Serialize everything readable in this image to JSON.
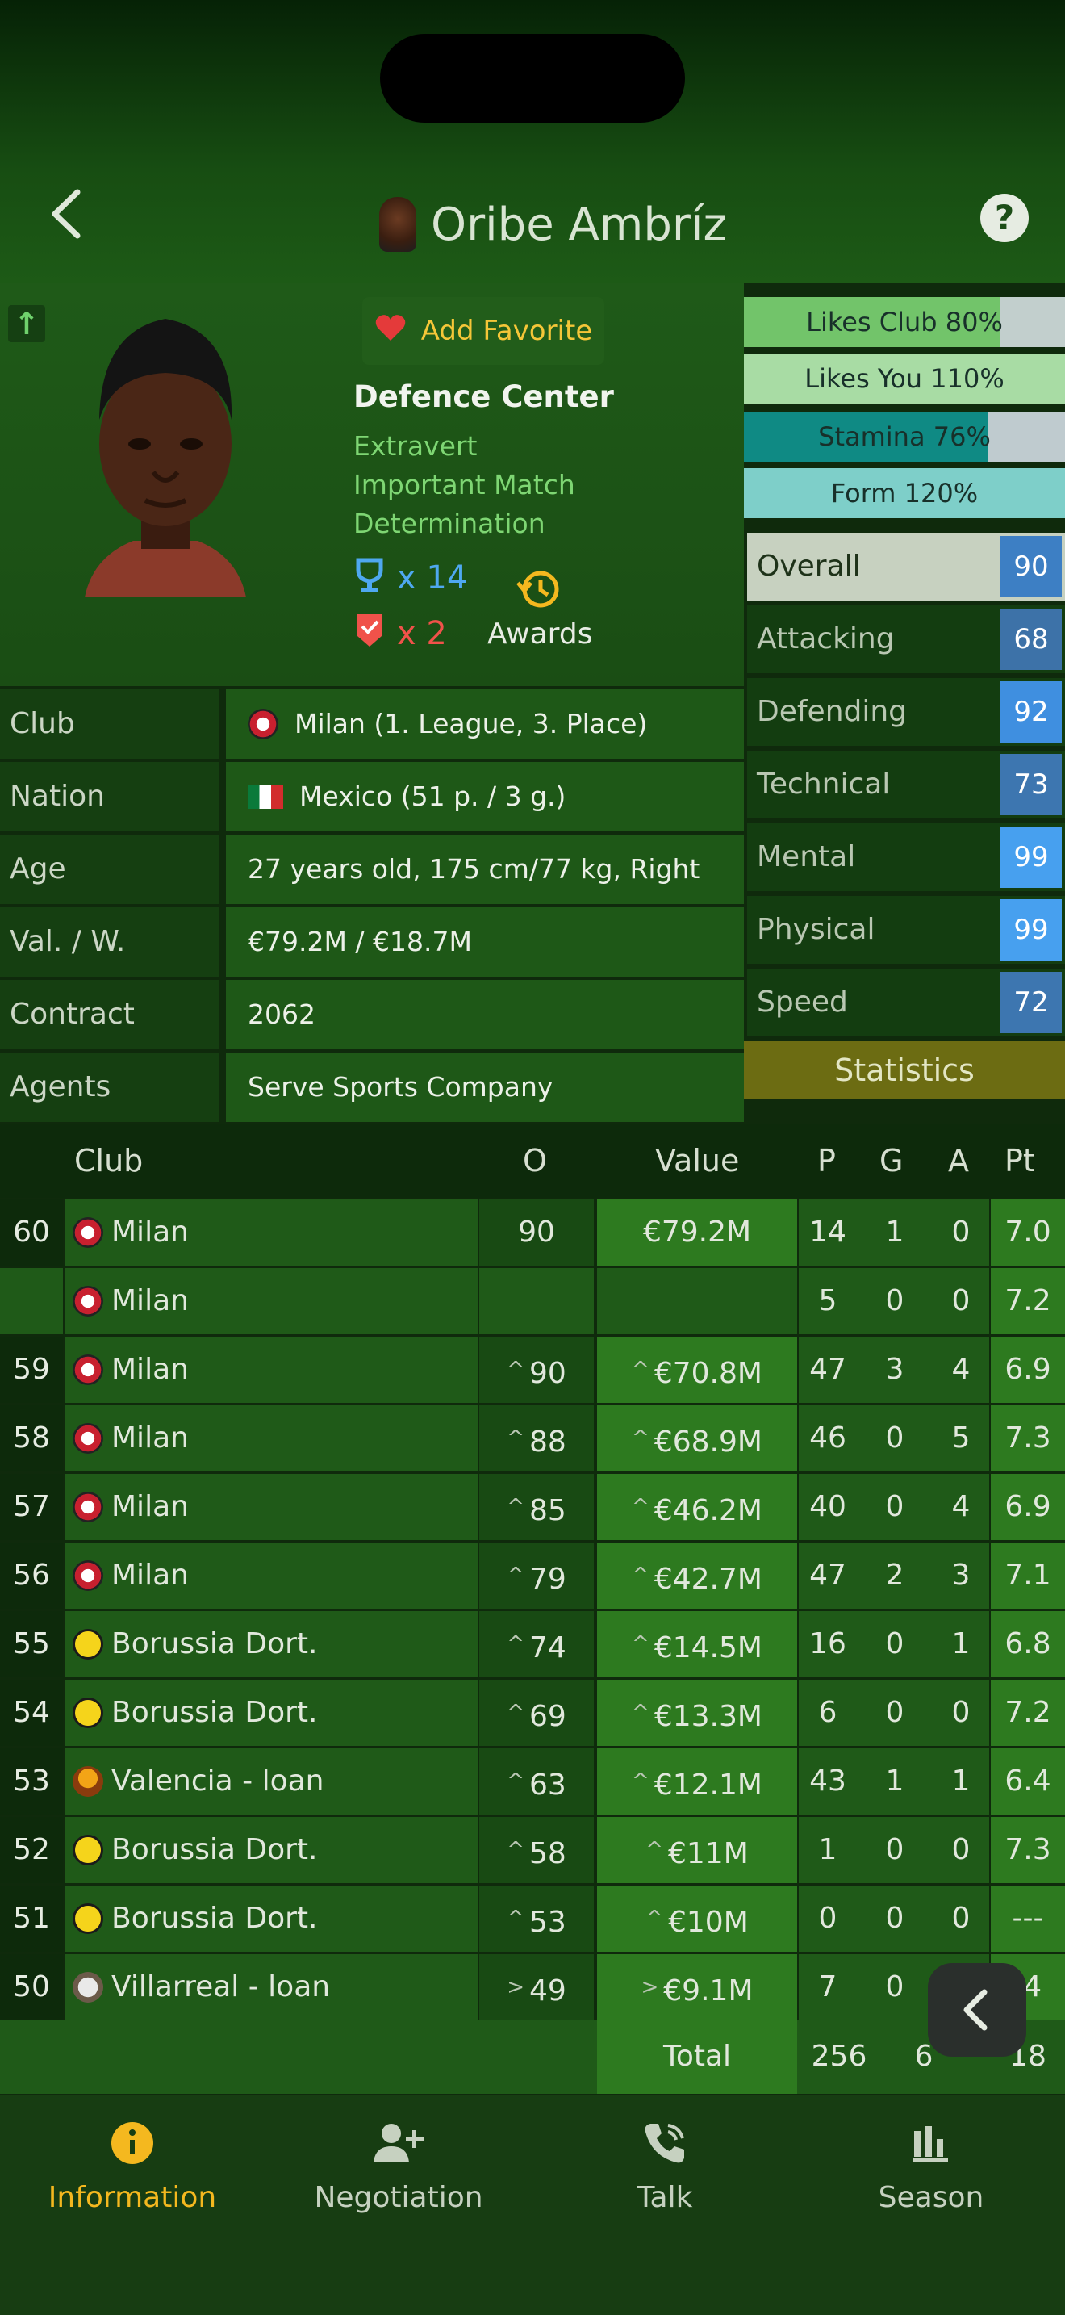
{
  "header": {
    "player_name": "Oribe Ambríz"
  },
  "profile": {
    "favorite_label": "Add Favorite",
    "position": "Defence Center",
    "traits": [
      "Extravert",
      "Important Match",
      "Determination"
    ],
    "trophies": "x 14",
    "red_cards": "x 2",
    "awards_label": "Awards"
  },
  "bars": [
    {
      "label": "Likes Club 80%",
      "pct": 80,
      "color": "#72c46a",
      "bg": "#c2cfcd"
    },
    {
      "label": "Likes You 110%",
      "pct": 100,
      "color": "#a8dca4",
      "bg": "#a8dca4"
    },
    {
      "label": "Stamina 76%",
      "pct": 76,
      "color": "#0f8a84",
      "bg": "#bfcbcf"
    },
    {
      "label": "Form 120%",
      "pct": 100,
      "color": "#7ecfc9",
      "bg": "#7ecfc9"
    }
  ],
  "attributes": [
    {
      "name": "Overall",
      "value": "90",
      "color": "#3d7fc4"
    },
    {
      "name": "Attacking",
      "value": "68",
      "color": "#3d72a8"
    },
    {
      "name": "Defending",
      "value": "92",
      "color": "#3f8fe0"
    },
    {
      "name": "Technical",
      "value": "73",
      "color": "#3d76b0"
    },
    {
      "name": "Mental",
      "value": "99",
      "color": "#47a0ef"
    },
    {
      "name": "Physical",
      "value": "99",
      "color": "#47a0ef"
    },
    {
      "name": "Speed",
      "value": "72",
      "color": "#3d76b0"
    }
  ],
  "statistics_label": "Statistics",
  "info": [
    {
      "key": "Club",
      "value": "Milan (1. League, 3. Place)"
    },
    {
      "key": "Nation",
      "value": "Mexico  (51 p. / 3 g.)"
    },
    {
      "key": "Age",
      "value": "27 years old, 175 cm/77 kg, Right"
    },
    {
      "key": "Val. / W.",
      "value": "€79.2M / €18.7M"
    },
    {
      "key": "Contract",
      "value": "2062"
    },
    {
      "key": "Agents",
      "value": "Serve Sports Company"
    }
  ],
  "table": {
    "headers": {
      "club": "Club",
      "o": "O",
      "value": "Value",
      "p": "P",
      "g": "G",
      "a": "A",
      "pt": "Pt"
    },
    "rows": [
      {
        "season": "60",
        "crest": "milan",
        "club": "Milan",
        "o": "90",
        "value": "€79.2M",
        "p": "14",
        "g": "1",
        "a": "0",
        "pt": "7.0",
        "up": ""
      },
      {
        "season": "",
        "crest": "milan",
        "club": "Milan",
        "o": "",
        "value": "",
        "p": "5",
        "g": "0",
        "a": "0",
        "pt": "7.2",
        "up": ""
      },
      {
        "season": "59",
        "crest": "milan",
        "club": "Milan",
        "o": "90",
        "value": "€70.8M",
        "p": "47",
        "g": "3",
        "a": "4",
        "pt": "6.9",
        "up": "^"
      },
      {
        "season": "58",
        "crest": "milan",
        "club": "Milan",
        "o": "88",
        "value": "€68.9M",
        "p": "46",
        "g": "0",
        "a": "5",
        "pt": "7.3",
        "up": "^"
      },
      {
        "season": "57",
        "crest": "milan",
        "club": "Milan",
        "o": "85",
        "value": "€46.2M",
        "p": "40",
        "g": "0",
        "a": "4",
        "pt": "6.9",
        "up": "^"
      },
      {
        "season": "56",
        "crest": "milan",
        "club": "Milan",
        "o": "79",
        "value": "€42.7M",
        "p": "47",
        "g": "2",
        "a": "3",
        "pt": "7.1",
        "up": "^"
      },
      {
        "season": "55",
        "crest": "bvb",
        "club": "Borussia Dort.",
        "o": "74",
        "value": "€14.5M",
        "p": "16",
        "g": "0",
        "a": "1",
        "pt": "6.8",
        "up": "^"
      },
      {
        "season": "54",
        "crest": "bvb",
        "club": "Borussia Dort.",
        "o": "69",
        "value": "€13.3M",
        "p": "6",
        "g": "0",
        "a": "0",
        "pt": "7.2",
        "up": "^"
      },
      {
        "season": "53",
        "crest": "val",
        "club": "Valencia - loan",
        "o": "63",
        "value": "€12.1M",
        "p": "43",
        "g": "1",
        "a": "1",
        "pt": "6.4",
        "up": "^"
      },
      {
        "season": "52",
        "crest": "bvb",
        "club": "Borussia Dort.",
        "o": "58",
        "value": "€11M",
        "p": "1",
        "g": "0",
        "a": "0",
        "pt": "7.3",
        "up": "^"
      },
      {
        "season": "51",
        "crest": "bvb",
        "club": "Borussia Dort.",
        "o": "53",
        "value": "€10M",
        "p": "0",
        "g": "0",
        "a": "0",
        "pt": "---",
        "up": "^"
      },
      {
        "season": "50",
        "crest": "vil",
        "club": "Villarreal - loan",
        "o": "49",
        "value": "€9.1M",
        "p": "7",
        "g": "0",
        "a": "",
        "pt": ".4",
        "up": ">"
      }
    ],
    "total": {
      "label": "Total",
      "p": "256",
      "g": "6",
      "pt": "18"
    }
  },
  "nav": [
    {
      "label": "Information",
      "icon": "info-icon",
      "active": true
    },
    {
      "label": "Negotiation",
      "icon": "add-user-icon",
      "active": false
    },
    {
      "label": "Talk",
      "icon": "phone-icon",
      "active": false
    },
    {
      "label": "Season",
      "icon": "bar-chart-icon",
      "active": false
    }
  ]
}
